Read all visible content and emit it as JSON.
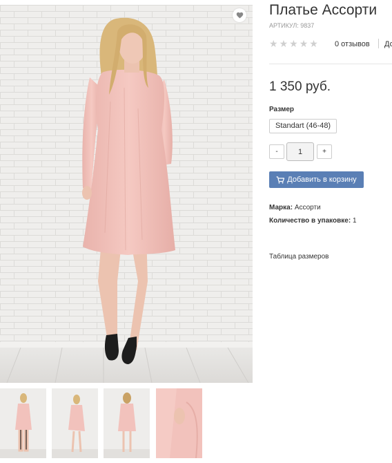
{
  "product": {
    "title": "Платье Ассорти",
    "sku": "АРТИКУЛ: 9837",
    "rating": {
      "stars": 0,
      "max": 5
    },
    "reviews": "0 отзывов",
    "add_review": "До",
    "price": "1 350 руб.",
    "size_label": "Размер",
    "size_option": "Standart (46-48)",
    "quantity": "1",
    "qty_minus": "-",
    "qty_plus": "+",
    "add_to_cart": "Добавить в корзину",
    "brand_label": "Марка:",
    "brand_value": "Ассорти",
    "pack_label": "Количество в упаковке:",
    "pack_value": "1",
    "size_table": "Таблица размеров"
  },
  "icons": {
    "wishlist": "heart-icon",
    "cart": "cart-icon",
    "rating": "star-icon"
  },
  "colors": {
    "accent": "#5a7fb5",
    "dress": "#f2c2bc",
    "star_empty": "#cfcfcf"
  }
}
